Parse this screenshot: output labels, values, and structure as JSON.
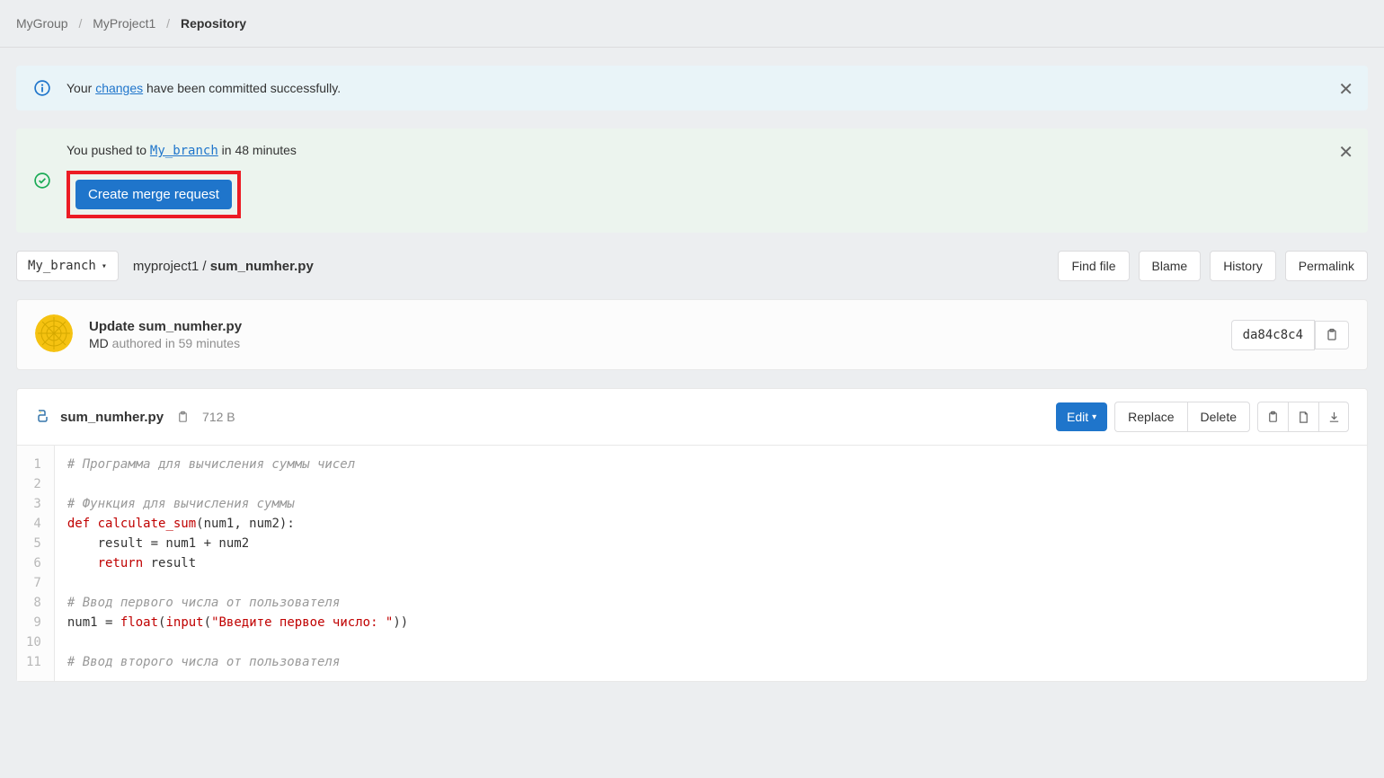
{
  "breadcrumb": {
    "group": "MyGroup",
    "project": "MyProject1",
    "current": "Repository"
  },
  "alert_commit": {
    "text_before": "Your ",
    "link": "changes",
    "text_after": " have been committed successfully."
  },
  "alert_push": {
    "text_before": "You pushed to ",
    "branch": "My_branch",
    "text_after": " in 48 minutes",
    "merge_btn": "Create merge request"
  },
  "branch_selector": "My_branch",
  "file_path": {
    "dir": "myproject1",
    "file": "sum_numher.py"
  },
  "actions": {
    "find_file": "Find file",
    "blame": "Blame",
    "history": "History",
    "permalink": "Permalink"
  },
  "commit": {
    "title": "Update sum_numher.py",
    "author": "MD",
    "meta": " authored in 59 minutes",
    "sha": "da84c8c4"
  },
  "file": {
    "name": "sum_numher.py",
    "size": "712 B",
    "edit": "Edit",
    "replace": "Replace",
    "delete": "Delete"
  },
  "code": {
    "lines": [
      {
        "n": "1",
        "html": "<span class='c-comment'># Программа для вычисления суммы чисел</span>"
      },
      {
        "n": "2",
        "html": ""
      },
      {
        "n": "3",
        "html": "<span class='c-comment'># Функция для вычисления суммы</span>"
      },
      {
        "n": "4",
        "html": "<span class='c-kw'>def</span> <span class='c-fn'>calculate_sum</span>(num1, num2):"
      },
      {
        "n": "5",
        "html": "    result = num1 + num2"
      },
      {
        "n": "6",
        "html": "    <span class='c-kw'>return</span> result"
      },
      {
        "n": "7",
        "html": ""
      },
      {
        "n": "8",
        "html": "<span class='c-comment'># Ввод первого числа от пользователя</span>"
      },
      {
        "n": "9",
        "html": "num1 = <span class='c-builtin'>float</span>(<span class='c-builtin'>input</span>(<span class='c-str'>\"Введите первое число: \"</span>))"
      },
      {
        "n": "10",
        "html": ""
      },
      {
        "n": "11",
        "html": "<span class='c-comment'># Ввод второго числа от пользователя</span>"
      }
    ]
  }
}
